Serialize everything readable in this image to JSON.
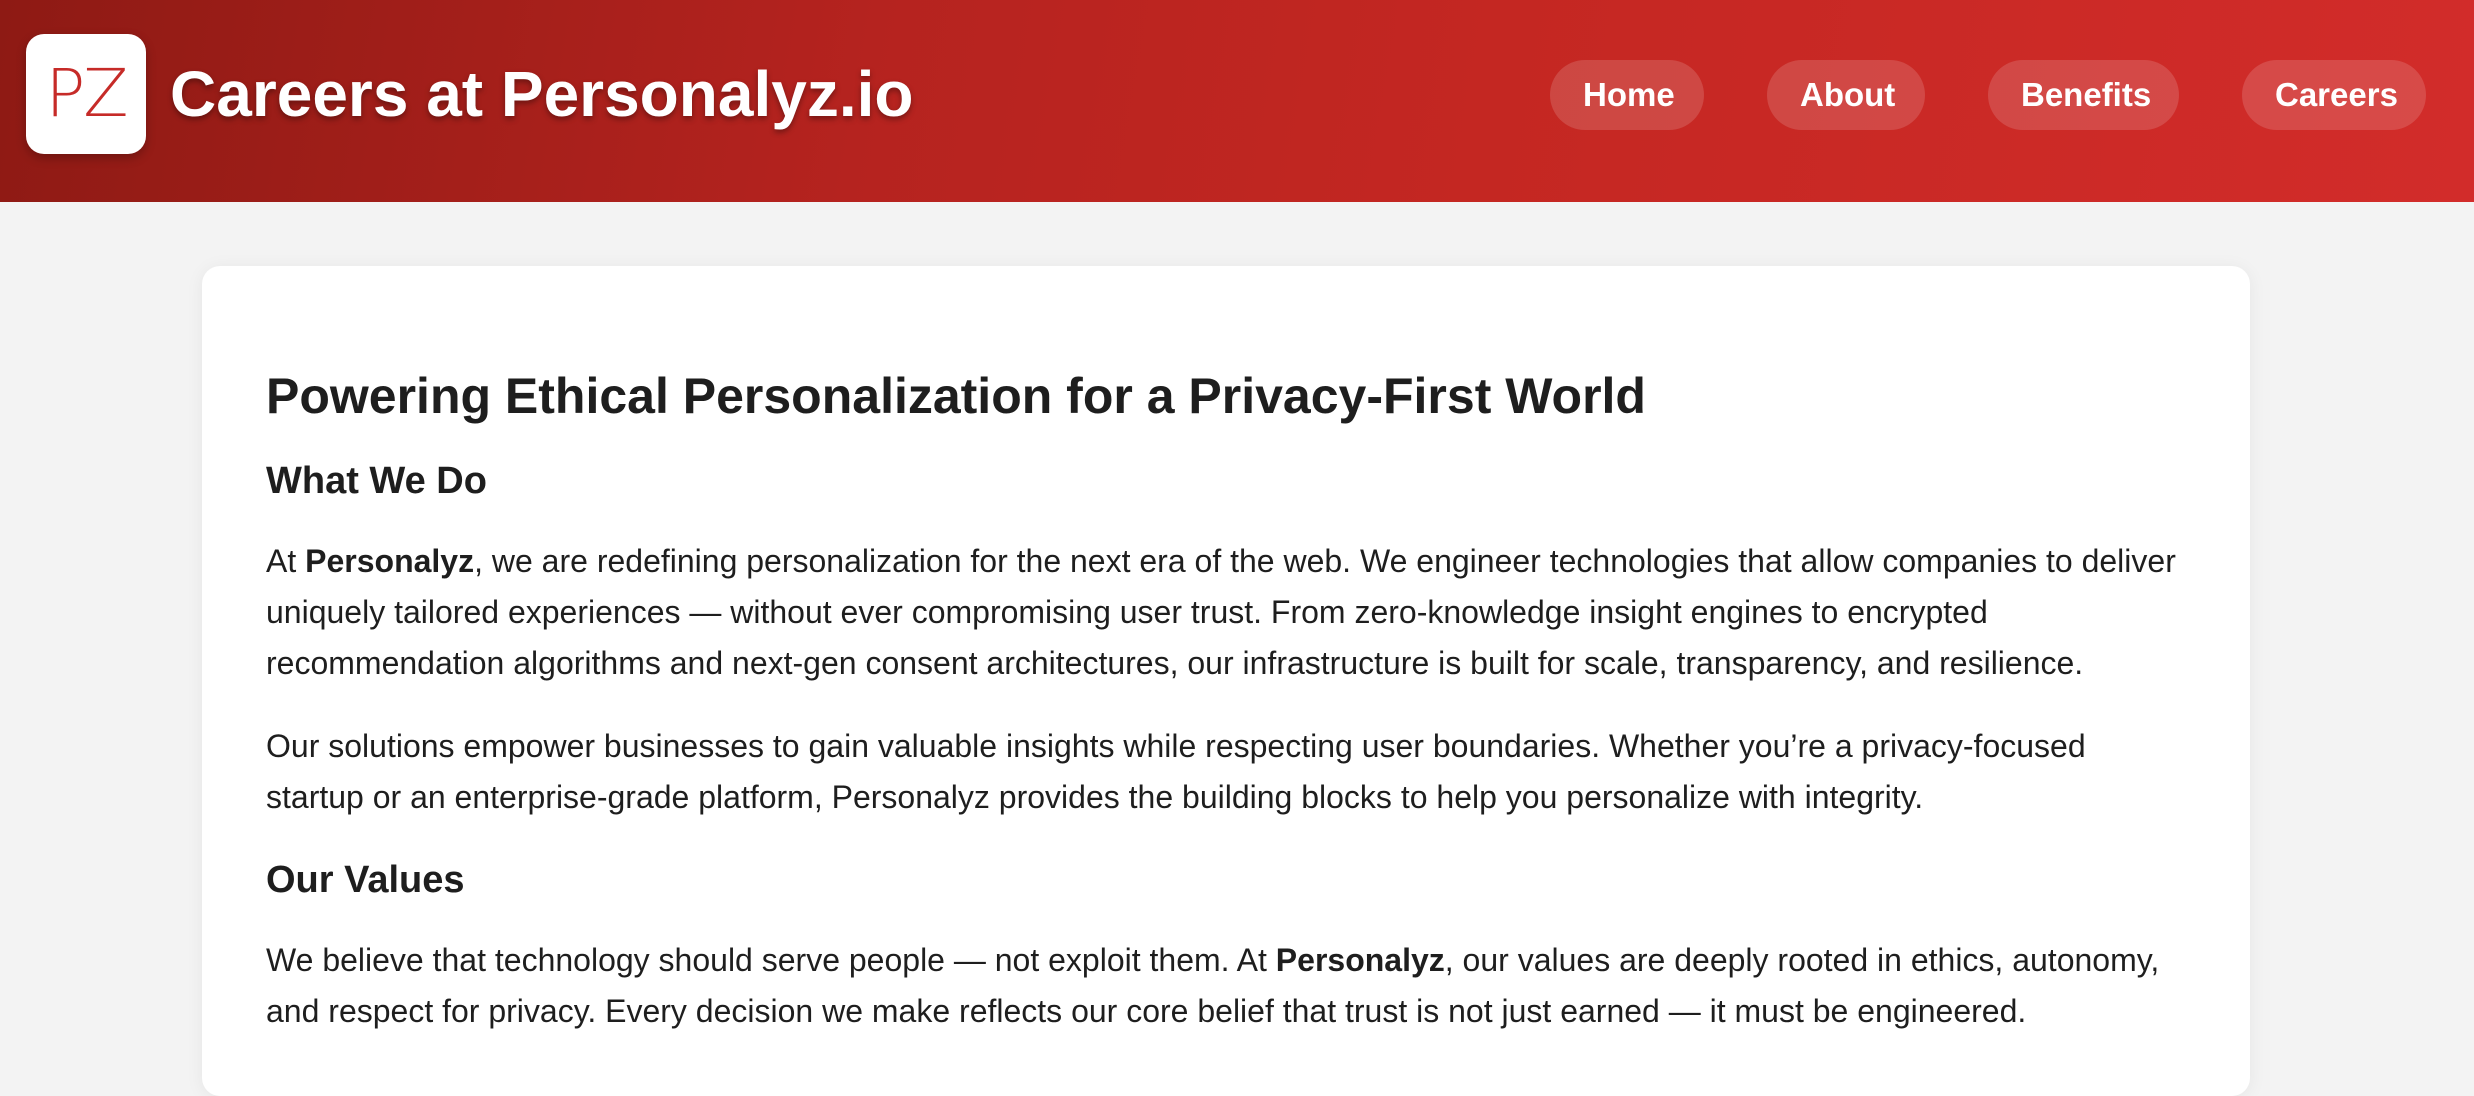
{
  "header": {
    "logo_text": "PZ",
    "title": "Careers at Personalyz.io",
    "nav": [
      "Home",
      "About",
      "Benefits",
      "Careers"
    ]
  },
  "content": {
    "heading": "Powering Ethical Personalization for a Privacy-First World",
    "section1": {
      "title": "What We Do",
      "p1": {
        "pre": "At ",
        "bold": "Personalyz",
        "post": ", we are redefining personalization for the next era of the web. We engineer technologies that allow companies to deliver uniquely tailored experiences — without ever compromising user trust. From zero-knowledge insight engines to encrypted recommendation algorithms and next-gen consent architectures, our infrastructure is built for scale, transparency, and resilience."
      },
      "p2": "Our solutions empower businesses to gain valuable insights while respecting user boundaries. Whether you’re a privacy-focused startup or an enterprise-grade platform, Personalyz provides the building blocks to help you personalize with integrity."
    },
    "section2": {
      "title": "Our Values",
      "p1": {
        "pre": "We believe that technology should serve people — not exploit them. At ",
        "bold": "Personalyz",
        "post": ", our values are deeply rooted in ethics, autonomy, and respect for privacy. Every decision we make reflects our core belief that trust is not just earned — it must be engineered."
      }
    }
  },
  "colors": {
    "header_start": "#8e1a14",
    "header_end": "#d22c2a",
    "logo_accent": "#c62b28",
    "page_bg": "#f3f3f3",
    "text": "#1e1e1e"
  }
}
